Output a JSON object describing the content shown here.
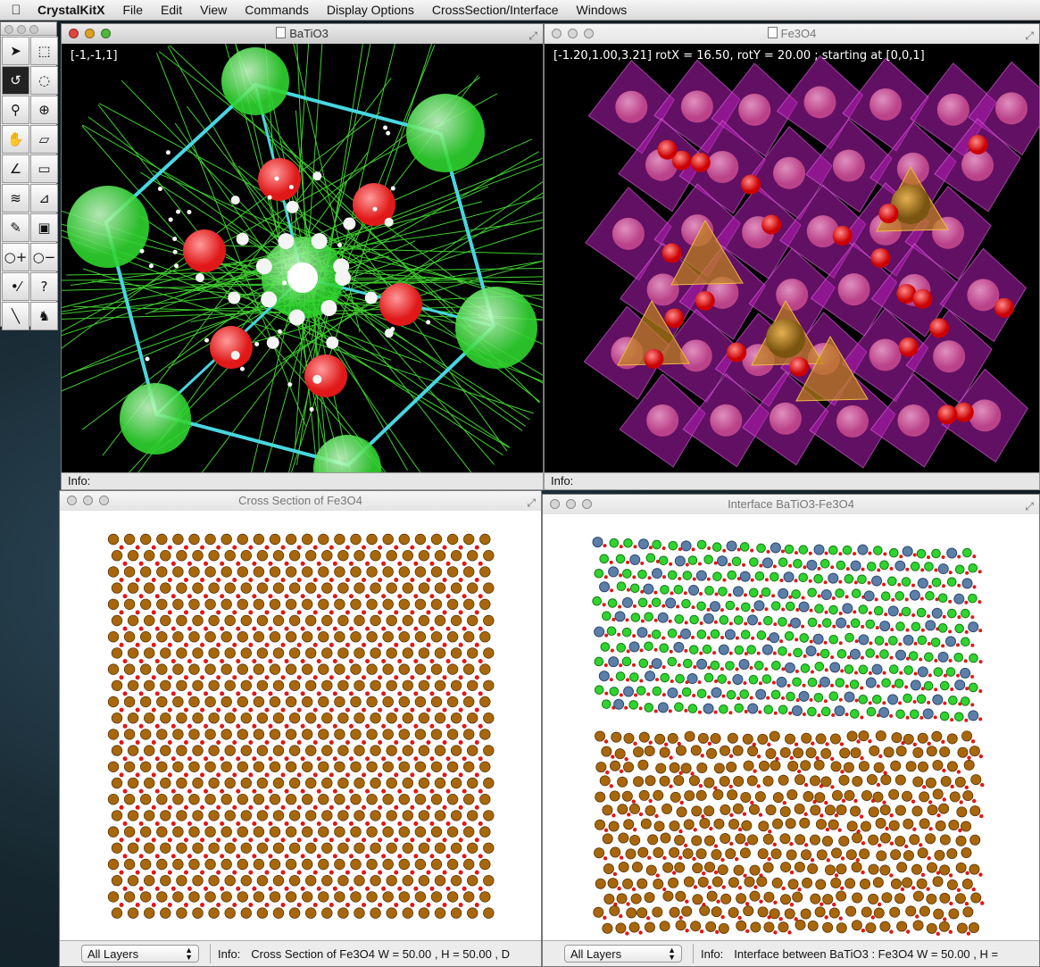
{
  "menubar": {
    "apple": "",
    "app_name": "CrystalKitX",
    "items": [
      "File",
      "Edit",
      "View",
      "Commands",
      "Display Options",
      "CrossSection/Interface",
      "Windows"
    ]
  },
  "palette": {
    "tools": [
      {
        "name": "arrow-select-icon",
        "glyph": "➤"
      },
      {
        "name": "marquee-select-icon",
        "glyph": "⬚"
      },
      {
        "name": "rotate-icon",
        "glyph": "↺"
      },
      {
        "name": "lasso-icon",
        "glyph": "◌"
      },
      {
        "name": "magnify-icon",
        "glyph": "⚲"
      },
      {
        "name": "sphere-rotate-icon",
        "glyph": "⊕"
      },
      {
        "name": "hand-pan-icon",
        "glyph": "✋"
      },
      {
        "name": "plane-icon",
        "glyph": "▱"
      },
      {
        "name": "angle-icon",
        "glyph": "∠"
      },
      {
        "name": "ruler-icon",
        "glyph": "▭"
      },
      {
        "name": "layers-icon",
        "glyph": "≋"
      },
      {
        "name": "axes-icon",
        "glyph": "⊿"
      },
      {
        "name": "eyedropper-icon",
        "glyph": "✎"
      },
      {
        "name": "image-icon",
        "glyph": "▣"
      },
      {
        "name": "add-atom-icon",
        "glyph": "○+"
      },
      {
        "name": "remove-atom-icon",
        "glyph": "○−"
      },
      {
        "name": "bond-icon",
        "glyph": "•⁄"
      },
      {
        "name": "help-icon",
        "glyph": "?"
      },
      {
        "name": "line-icon",
        "glyph": "╲"
      },
      {
        "name": "animal-icon",
        "glyph": "♞"
      }
    ]
  },
  "windows": {
    "batio3": {
      "title": "BaTiO3",
      "overlay": "[-1,-1,1]",
      "info": "Info:"
    },
    "fe3o4": {
      "title": "Fe3O4",
      "overlay": "[-1.20,1.00,3.21] rotX = 16.50, rotY = 20.00 ; starting at [0,0,1]",
      "info": "Info:"
    },
    "cross": {
      "title": "Cross Section of Fe3O4",
      "layers": "All Layers",
      "info_label": "Info:",
      "info": "Cross Section of Fe3O4 W = 50.00 , H = 50.00 , D"
    },
    "interface": {
      "title": "Interface BaTiO3-Fe3O4",
      "layers": "All Layers",
      "info_label": "Info:",
      "info": "Interface between BaTiO3 : Fe3O4 W = 50.00 , H ="
    }
  },
  "colors": {
    "ba_green": "#2fd42f",
    "o_red": "#e01818",
    "fe_brown": "#a8670c",
    "octa_magenta": "#b21eb4",
    "tetra_gold": "#c0861a",
    "ti_blue": "#5c7fa8",
    "cell_cyan": "#49d6e0"
  }
}
